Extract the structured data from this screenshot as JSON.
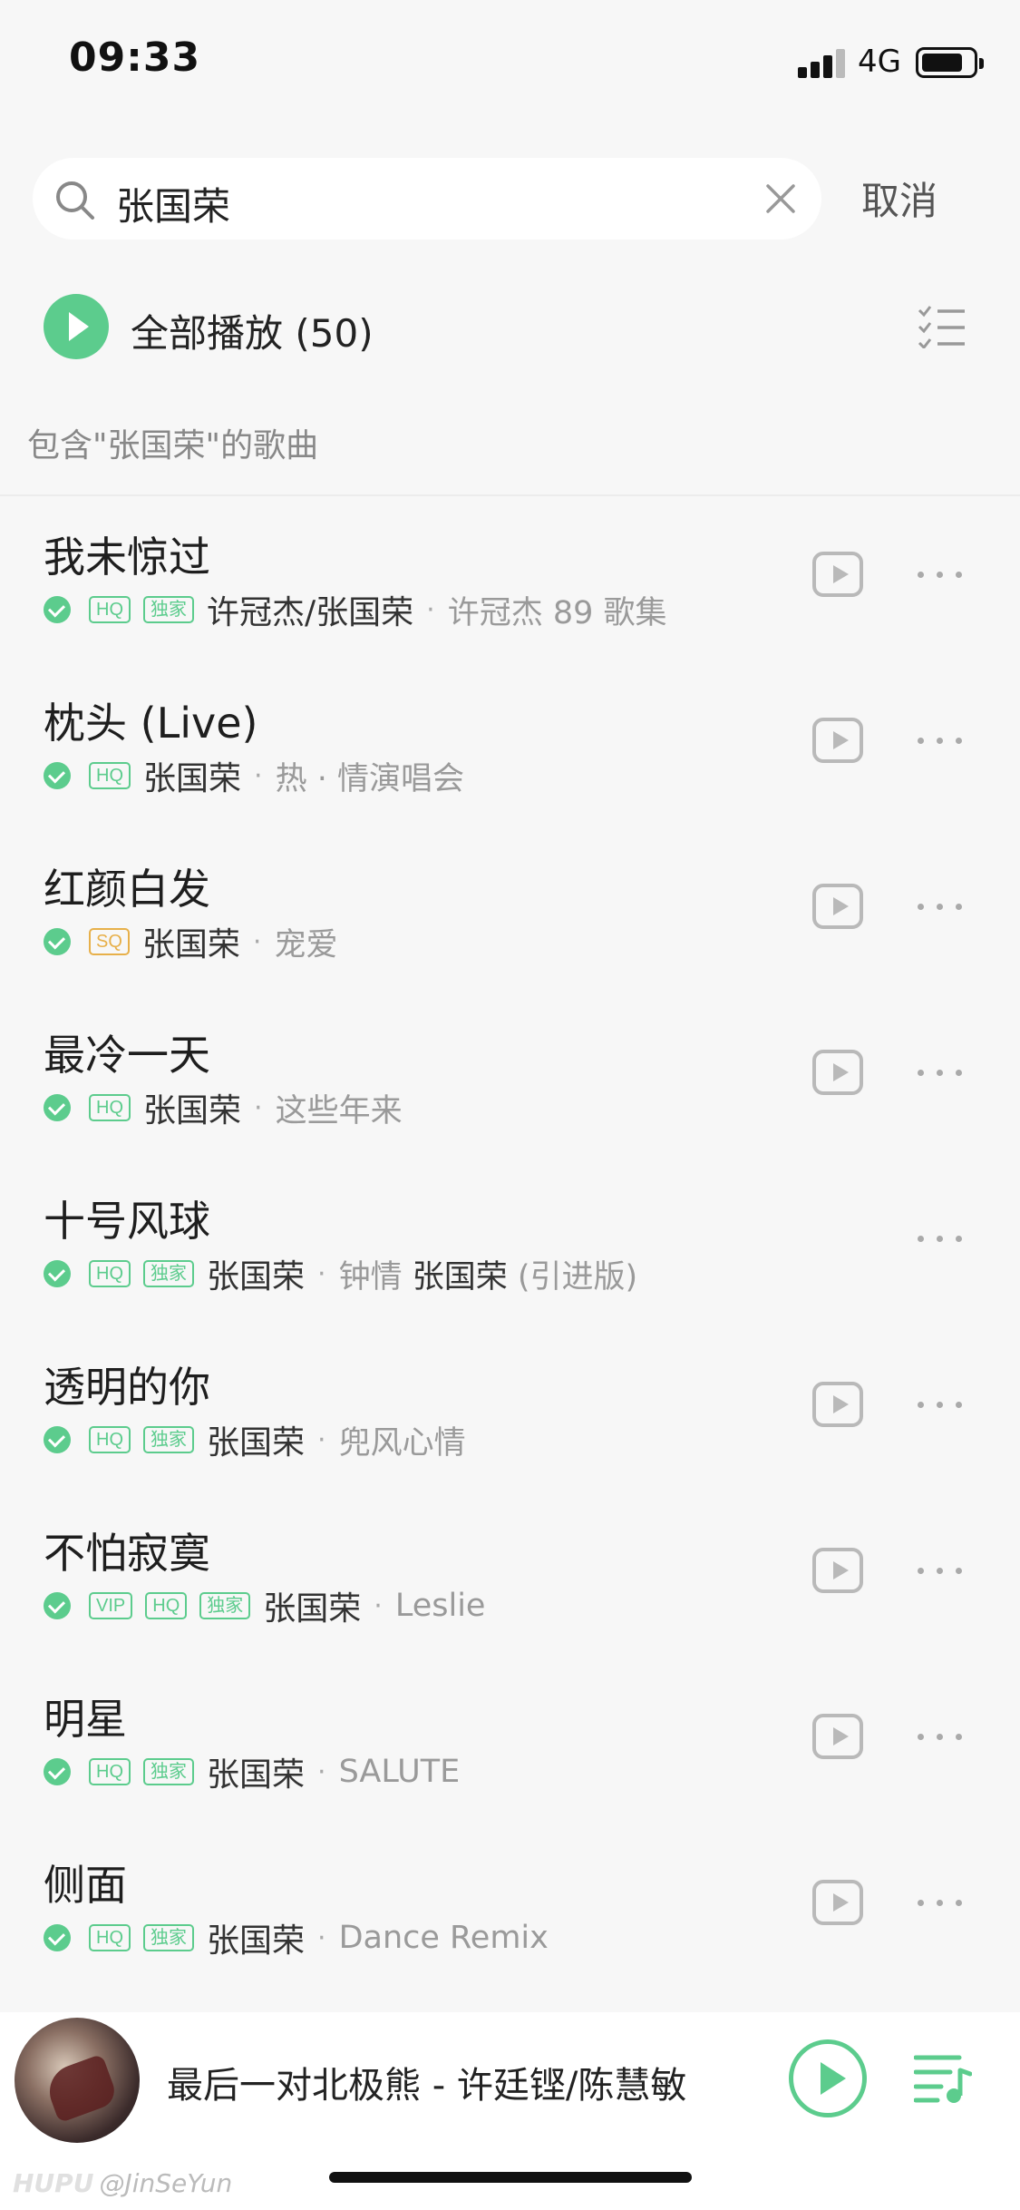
{
  "status_bar": {
    "time": "09:33",
    "network": "4G"
  },
  "search": {
    "query": "张国荣",
    "cancel_label": "取消"
  },
  "play_all": {
    "label": "全部播放",
    "count": "(50)"
  },
  "section_label": "包含\"张国荣\"的歌曲",
  "songs": [
    {
      "title": "我未惊过",
      "badges": [
        "HQ",
        "独家"
      ],
      "artist": "许冠杰/张国荣",
      "album": "许冠杰 89 歌集",
      "album_highlight": "",
      "has_mv": true
    },
    {
      "title": "枕头 (Live)",
      "badges": [
        "HQ"
      ],
      "artist": "张国荣",
      "album": "热 · 情演唱会",
      "album_highlight": "",
      "has_mv": true
    },
    {
      "title": "红颜白发",
      "badges": [
        "SQ"
      ],
      "artist": "张国荣",
      "album": "宠爱",
      "album_highlight": "",
      "has_mv": true
    },
    {
      "title": "最冷一天",
      "badges": [
        "HQ"
      ],
      "artist": "张国荣",
      "album": "这些年来",
      "album_highlight": "",
      "has_mv": true
    },
    {
      "title": "十号风球",
      "badges": [
        "HQ",
        "独家"
      ],
      "artist": "张国荣",
      "album": "钟情 ",
      "album_highlight": "张国荣",
      "album_suffix": " (引进版)",
      "has_mv": false
    },
    {
      "title": "透明的你",
      "badges": [
        "HQ",
        "独家"
      ],
      "artist": "张国荣",
      "album": "兜风心情",
      "album_highlight": "",
      "has_mv": true
    },
    {
      "title": "不怕寂寞",
      "badges": [
        "VIP",
        "HQ",
        "独家"
      ],
      "artist": "张国荣",
      "album": "Leslie",
      "album_highlight": "",
      "has_mv": true
    },
    {
      "title": "明星",
      "badges": [
        "HQ",
        "独家"
      ],
      "artist": "张国荣",
      "album": "SALUTE",
      "album_highlight": "",
      "has_mv": true
    },
    {
      "title": "侧面",
      "badges": [
        "HQ",
        "独家"
      ],
      "artist": "张国荣",
      "album": "Dance Remix",
      "album_highlight": "",
      "has_mv": true
    }
  ],
  "player": {
    "now_playing": "最后一对北极熊 - 许廷铿/陈慧敏"
  },
  "watermark": {
    "site": "HUPU",
    "user": "@JinSeYun"
  },
  "colors": {
    "accent": "#5ccc8d",
    "sq_badge": "#e7b04a",
    "secondary_text": "#9a9a9a"
  },
  "icons": {
    "search": "search-icon",
    "clear": "close-icon",
    "play_all": "play-circle-icon",
    "multi_select": "checklist-icon",
    "mv": "video-play-icon",
    "more": "more-dots-icon",
    "playlist": "playlist-icon"
  }
}
